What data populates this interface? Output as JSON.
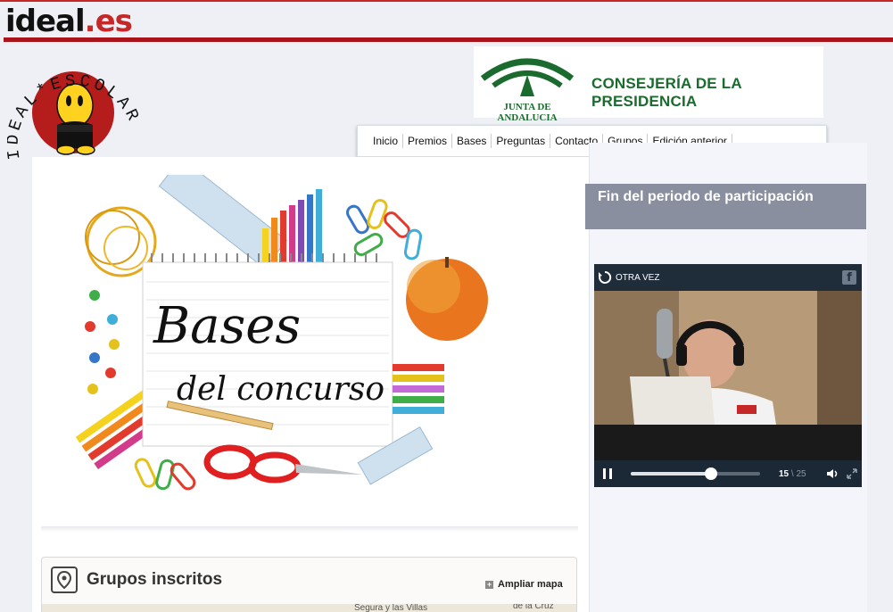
{
  "header": {
    "site_name": "ideal",
    "site_tld": ".es"
  },
  "escolar_logo": {
    "text": "IDEAL*ESCOLAR"
  },
  "junta_banner": {
    "org_name": "JUNTA DE ANDALUCIA",
    "department": "CONSEJERÍA DE LA PRESIDENCIA"
  },
  "nav": {
    "items": [
      "Inicio",
      "Premios",
      "Bases",
      "Preguntas",
      "Contacto",
      "Grupos",
      "Edición anterior"
    ]
  },
  "banner": {
    "line1": "Bases",
    "line2": "del concurso"
  },
  "grupos": {
    "title": "Grupos inscritos",
    "expand_label": "Ampliar mapa",
    "map_labels": [
      "Segura y las Villas",
      "de la Cruz"
    ]
  },
  "sidebar": {
    "status_title": "Fin del periodo de participación"
  },
  "video": {
    "replay_label": "OTRA VEZ",
    "facebook_glyph": "f",
    "current_time": "15",
    "separator": "\\",
    "total_time": "25",
    "progress": 0.62
  },
  "colors": {
    "brand_red": "#a8141a",
    "junta_green": "#1b6b2e",
    "status_box": "#8a8fa0",
    "video_bg": "#22303e"
  }
}
